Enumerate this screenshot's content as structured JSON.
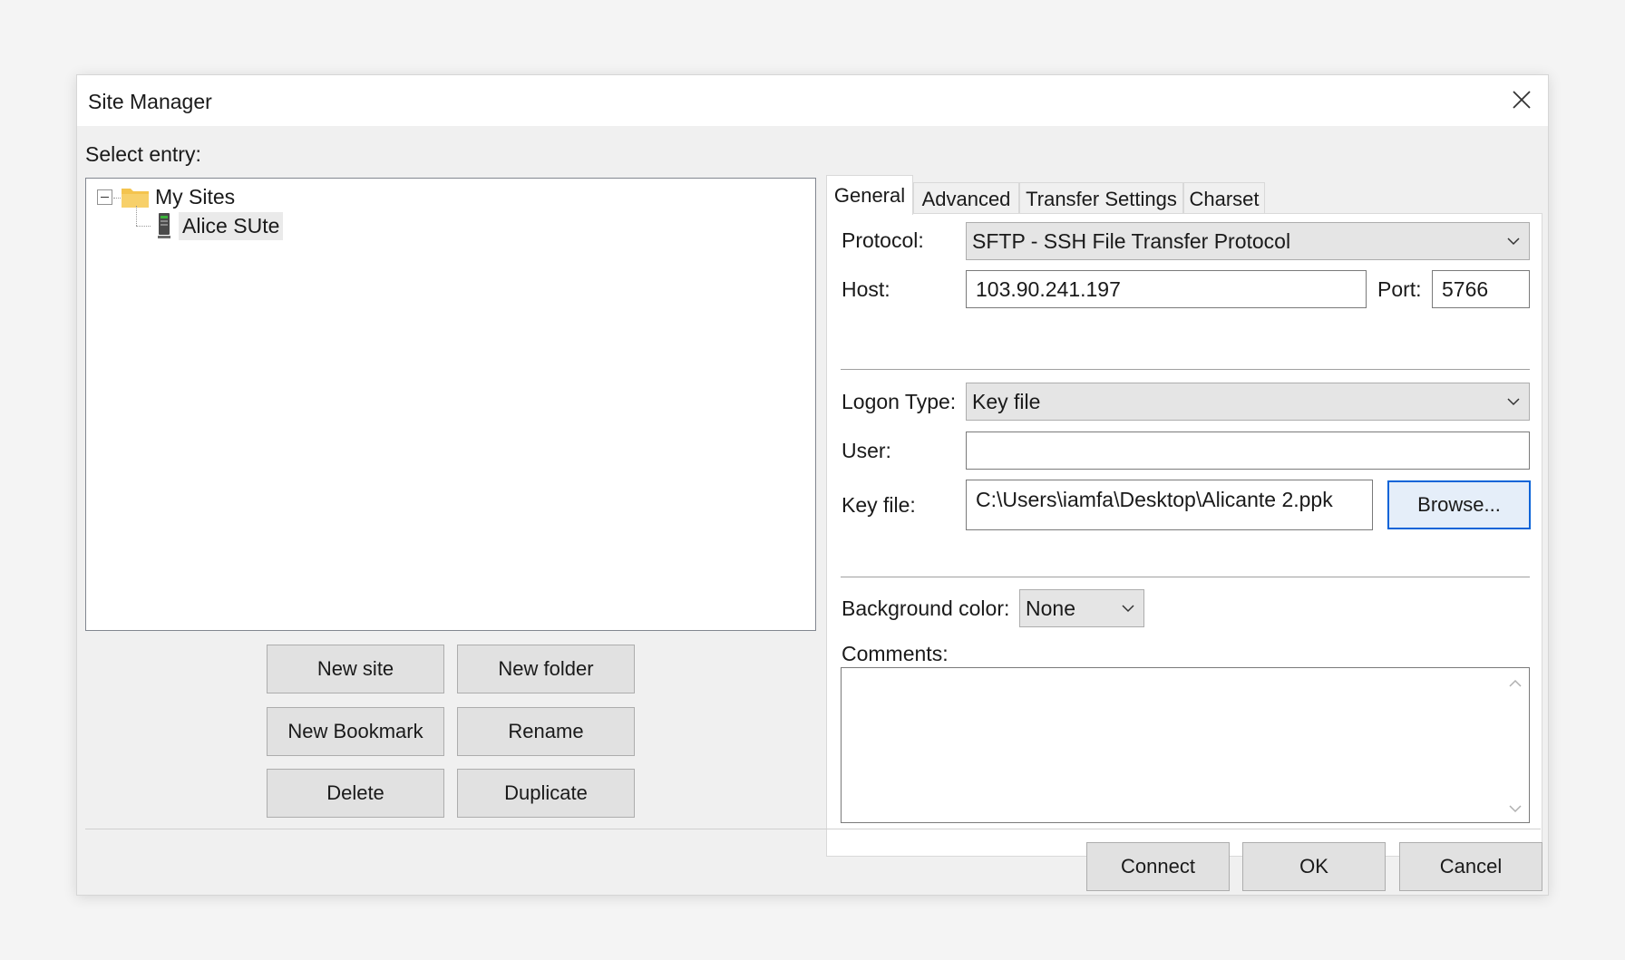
{
  "window": {
    "title": "Site Manager"
  },
  "left": {
    "select_entry_label": "Select entry:",
    "tree": {
      "root_label": "My Sites",
      "child_label": "Alice SUte"
    },
    "buttons": {
      "new_site": "New site",
      "new_folder": "New folder",
      "new_bookmark": "New Bookmark",
      "rename": "Rename",
      "delete": "Delete",
      "duplicate": "Duplicate"
    }
  },
  "tabs": [
    "General",
    "Advanced",
    "Transfer Settings",
    "Charset"
  ],
  "general": {
    "protocol_label": "Protocol:",
    "protocol_value": "SFTP - SSH File Transfer Protocol",
    "host_label": "Host:",
    "host_value": "103.90.241.197",
    "port_label": "Port:",
    "port_value": "5766",
    "logon_type_label": "Logon Type:",
    "logon_type_value": "Key file",
    "user_label": "User:",
    "user_value": "",
    "key_file_label": "Key file:",
    "key_file_value": "C:\\Users\\iamfa\\Desktop\\Alicante 2.ppk",
    "browse_label": "Browse...",
    "bg_color_label": "Background color:",
    "bg_color_value": "None",
    "comments_label": "Comments:",
    "comments_value": ""
  },
  "footer": {
    "connect": "Connect",
    "ok": "OK",
    "cancel": "Cancel"
  },
  "icons": {
    "close": "close-icon",
    "folder": "folder-icon",
    "server": "server-icon",
    "expander": "collapse-icon",
    "dropdown": "chevron-down-icon"
  },
  "colors": {
    "focus_border": "#0a64d8",
    "folder": "#f4c44e"
  }
}
